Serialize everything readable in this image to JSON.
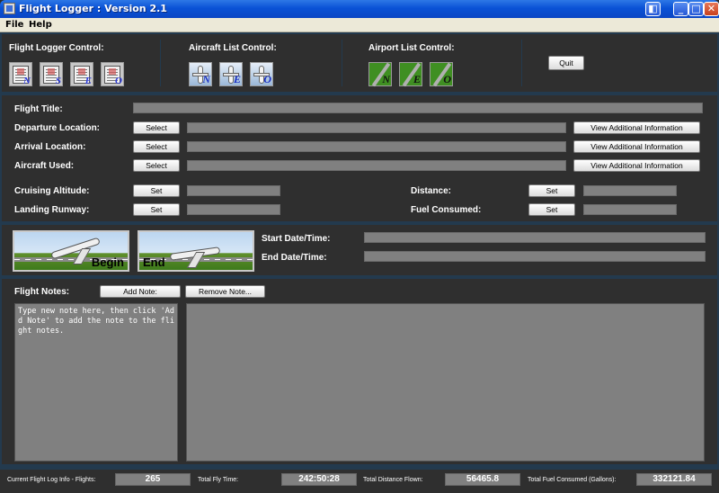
{
  "window": {
    "title": "Flight Logger : Version 2.1"
  },
  "menu": [
    {
      "label": "File"
    },
    {
      "label": "Help"
    }
  ],
  "toolbar": {
    "flight_logger_label": "Flight Logger Control:",
    "aircraft_list_label": "Aircraft List Control:",
    "airport_list_label": "Airport List Control:",
    "flight_logger_buttons": [
      {
        "letter": "N"
      },
      {
        "letter": "S"
      },
      {
        "letter": "E"
      },
      {
        "letter": "O"
      }
    ],
    "aircraft_buttons": [
      {
        "letter": "N"
      },
      {
        "letter": "E"
      },
      {
        "letter": "O"
      }
    ],
    "airport_buttons": [
      {
        "letter": "N"
      },
      {
        "letter": "E"
      },
      {
        "letter": "O"
      }
    ],
    "quit_label": "Quit"
  },
  "flight": {
    "title_label": "Flight Title:",
    "title_value": "",
    "departure_label": "Departure Location:",
    "departure_value": "",
    "arrival_label": "Arrival Location:",
    "arrival_value": "",
    "aircraft_label": "Aircraft Used:",
    "aircraft_value": "",
    "select_label": "Select",
    "view_info_label": "View Additional Information",
    "cruising_label": "Cruising Altitude:",
    "cruising_value": "",
    "landing_label": "Landing Runway:",
    "landing_value": "",
    "distance_label": "Distance:",
    "distance_value": "",
    "fuel_label": "Fuel Consumed:",
    "fuel_value": "",
    "set_label": "Set"
  },
  "timing": {
    "begin_label": "Begin",
    "end_label": "End",
    "start_label": "Start Date/Time:",
    "start_value": "",
    "end_dt_label": "End Date/Time:",
    "end_value": ""
  },
  "notes": {
    "label": "Flight Notes:",
    "add_label": "Add Note:",
    "remove_label": "Remove Note...",
    "input_text": "Type new note here, then click 'Add Note' to add the note to the flight notes.",
    "list_text": ""
  },
  "status": {
    "flights_label": "Current Flight Log Info - Flights:",
    "flights_value": "265",
    "flytime_label": "Total Fly Time:",
    "flytime_value": "242:50:28",
    "distance_label": "Total Distance Flown:",
    "distance_value": "56465.8",
    "fuel_label": "Total Fuel Consumed (Gallons):",
    "fuel_value": "332121.84"
  },
  "colors": {
    "panel": "#2f2f2f",
    "frame": "#233a4e",
    "field": "#808080",
    "titlebar": "#0a52d6"
  }
}
